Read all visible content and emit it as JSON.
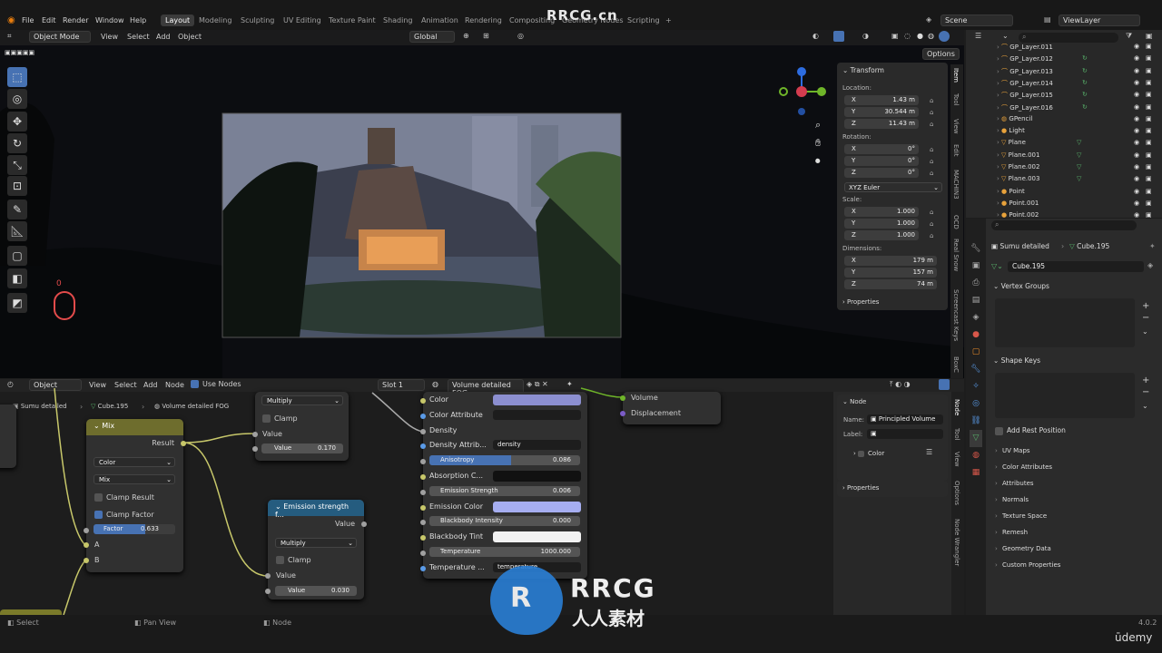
{
  "menubar": {
    "items": [
      "File",
      "Edit",
      "Render",
      "Window",
      "Help"
    ],
    "workspaces": [
      "Layout",
      "Modeling",
      "Sculpting",
      "UV Editing",
      "Texture Paint",
      "Shading",
      "Animation",
      "Rendering",
      "Compositing",
      "Geometry Nodes",
      "Scripting"
    ],
    "add_tab": "+",
    "scene": "Scene",
    "view_layer": "ViewLayer"
  },
  "viewport": {
    "mode": "Object Mode",
    "menus": [
      "View",
      "Select",
      "Add",
      "Object"
    ],
    "transform": "Global",
    "options": "Options",
    "mouse_counter": "0"
  },
  "npanel": {
    "transform": "Transform",
    "location": "Location:",
    "rotation": "Rotation:",
    "scale": "Scale:",
    "dimensions": "Dimensions:",
    "loc": [
      [
        "X",
        "1.43 m"
      ],
      [
        "Y",
        "30.544 m"
      ],
      [
        "Z",
        "11.43 m"
      ]
    ],
    "rot": [
      [
        "X",
        "0°"
      ],
      [
        "Y",
        "0°"
      ],
      [
        "Z",
        "0°"
      ]
    ],
    "euler": "XYZ Euler",
    "scl": [
      [
        "X",
        "1.000"
      ],
      [
        "Y",
        "1.000"
      ],
      [
        "Z",
        "1.000"
      ]
    ],
    "dim": [
      [
        "X",
        "179 m"
      ],
      [
        "Y",
        "157 m"
      ],
      [
        "Z",
        "74 m"
      ]
    ],
    "properties": "Properties",
    "tabs": [
      "Item",
      "Tool",
      "View",
      "Edit",
      "MACHIN3",
      "OCD",
      "Real Snow",
      "Screencast Keys",
      "BoxC"
    ]
  },
  "outliner": {
    "rows": [
      "GP_Layer.011",
      "GP_Layer.012",
      "GP_Layer.013",
      "GP_Layer.014",
      "GP_Layer.015",
      "GP_Layer.016",
      "GPencil",
      "Light",
      "Plane",
      "Plane.001",
      "Plane.002",
      "Plane.003",
      "Point",
      "Point.001",
      "Point.002"
    ]
  },
  "props": {
    "object": "Sumu detailed",
    "mesh": "Cube.195",
    "mesh_field": "Cube.195",
    "vertex_groups": "Vertex Groups",
    "shape_keys": "Shape Keys",
    "add_rest": "Add Rest Position",
    "sections": [
      "UV Maps",
      "Color Attributes",
      "Attributes",
      "Normals",
      "Texture Space",
      "Remesh",
      "Geometry Data",
      "Custom Properties"
    ]
  },
  "nodeeditor": {
    "header": {
      "object": "Object",
      "menus": [
        "View",
        "Select",
        "Add",
        "Node"
      ],
      "use_nodes": "Use Nodes",
      "slot": "Slot 1",
      "material": "Volume detailed FOG"
    },
    "breadcrumb": [
      "Sumu detailed",
      "Cube.195",
      "Volume detailed FOG"
    ],
    "mix": {
      "title": "Mix",
      "result": "Result",
      "color": "Color",
      "mix": "Mix",
      "clamp_result": "Clamp Result",
      "clamp_factor": "Clamp Factor",
      "factor_label": "Factor",
      "factor": "0.633",
      "factor_value": 0.633,
      "a": "A",
      "b": "B"
    },
    "multiply1": {
      "op": "Multiply",
      "clamp": "Clamp",
      "value_out": "Value",
      "value_label": "Value",
      "value": "0.170"
    },
    "emission": {
      "title": "Emission strength f...",
      "value_out": "Value",
      "op": "Multiply",
      "clamp": "Clamp",
      "value_in": "Value",
      "value_label": "Value",
      "value": "0.030"
    },
    "principled": {
      "rows": [
        {
          "label": "Color",
          "kind": "color",
          "color": "#8c8fd0"
        },
        {
          "label": "Color Attribute",
          "kind": "field",
          "value": ""
        },
        {
          "label": "Density",
          "kind": "plain"
        },
        {
          "label": "Density Attrib...",
          "kind": "field",
          "value": "density"
        },
        {
          "label": "Anisotropy",
          "kind": "slider",
          "value": "0.086"
        },
        {
          "label": "Absorption C...",
          "kind": "color",
          "color": "#111111"
        },
        {
          "label": "Emission Strength",
          "kind": "slider",
          "value": "0.006"
        },
        {
          "label": "Emission Color",
          "kind": "color",
          "color": "#a6aef0"
        },
        {
          "label": "Blackbody Intensity",
          "kind": "slider",
          "value": "0.000"
        },
        {
          "label": "Blackbody Tint",
          "kind": "color",
          "color": "#f2f2f2"
        },
        {
          "label": "Temperature",
          "kind": "slider",
          "value": "1000.000"
        },
        {
          "label": "Temperature ...",
          "kind": "field",
          "value": "temperature"
        }
      ]
    },
    "output": {
      "volume": "Volume",
      "displacement": "Displacement"
    },
    "side": {
      "node": "Node",
      "name_label": "Name:",
      "name": "Principled Volume",
      "label_label": "Label:",
      "color": "Color",
      "properties": "Properties",
      "tabs": [
        "Node",
        "Tool",
        "View",
        "Options",
        "Node Wrangler"
      ]
    }
  },
  "statusbar": {
    "select": "Select",
    "pan": "Pan View",
    "node": "Node",
    "version": "4.0.2",
    "brand": "ūdemy"
  },
  "watermark": {
    "rrcg_top": "RRCG.cn",
    "rrcg": "RRCG",
    "cn": "人人素材"
  }
}
